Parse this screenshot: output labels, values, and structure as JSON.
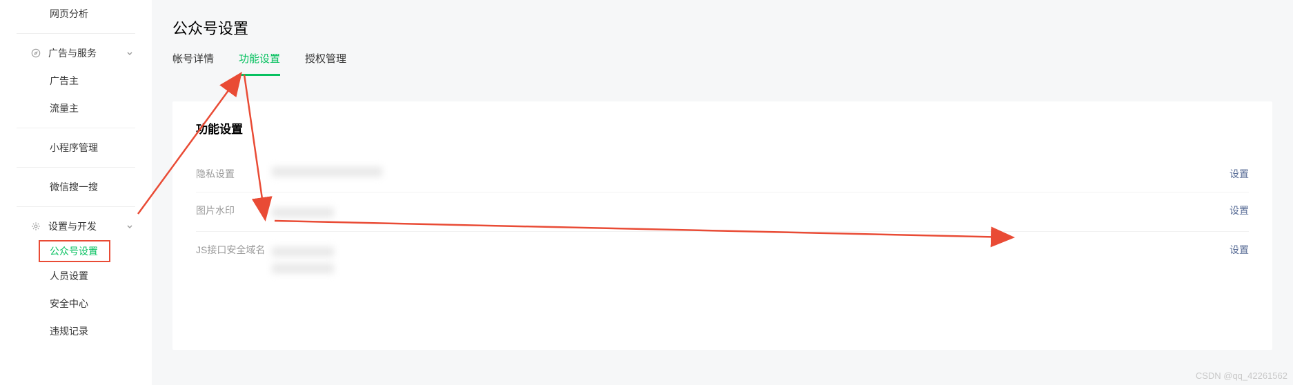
{
  "sidebar": {
    "top_item": "网页分析",
    "section_ads": {
      "title": "广告与服务",
      "items": [
        "广告主",
        "流量主",
        "小程序管理",
        "微信搜一搜"
      ]
    },
    "section_dev": {
      "title": "设置与开发",
      "items": [
        "公众号设置",
        "人员设置",
        "安全中心",
        "违规记录"
      ],
      "active_index": 0
    }
  },
  "page": {
    "title": "公众号设置",
    "tabs": [
      "帐号详情",
      "功能设置",
      "授权管理"
    ],
    "active_tab": 1
  },
  "panel": {
    "title": "功能设置",
    "rows": [
      {
        "label": "隐私设置",
        "action": "设置"
      },
      {
        "label": "图片水印",
        "action": "设置"
      },
      {
        "label": "JS接口安全域名",
        "action": "设置"
      }
    ]
  },
  "watermark": "CSDN @qq_42261562"
}
